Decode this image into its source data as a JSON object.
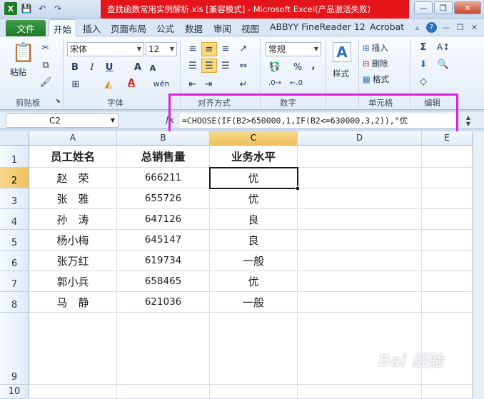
{
  "window": {
    "title": "查找函数常用实例解析.xls  [兼容模式] - Microsoft Excel(产品激活失败)",
    "buttons": {
      "minimize": "—",
      "restore": "❐",
      "close": "✕"
    }
  },
  "qat": {
    "save": "💾",
    "undo": "↶",
    "redo": "↷"
  },
  "tabs": {
    "file": "文件",
    "items": [
      "开始",
      "插入",
      "页面布局",
      "公式",
      "数据",
      "审阅",
      "视图",
      "ABBYY FineReader 12",
      "Acrobat"
    ],
    "active": "开始"
  },
  "ribbon": {
    "clipboard": {
      "paste": "粘贴",
      "label": "剪贴板"
    },
    "font": {
      "name": "宋体",
      "size": "12",
      "bold": "B",
      "italic": "I",
      "underline": "U",
      "grow": "A",
      "shrink": "A",
      "fontcolor": "A",
      "label": "字体"
    },
    "alignment": {
      "label": "对齐方式"
    },
    "number": {
      "format": "常规",
      "percent": "%",
      "comma": ",",
      "label": "数字"
    },
    "styles": {
      "label": "样式"
    },
    "cells": {
      "insert": "插入",
      "delete": "删除",
      "format": "格式",
      "label": "单元格"
    },
    "editing": {
      "sum": "Σ",
      "label": "编辑"
    }
  },
  "formula_bar": {
    "name_box": "C2",
    "fx": "fx",
    "formula": "=CHOOSE(IF(B2>650000,1,IF(B2<=630000,3,2)),\"优"
  },
  "grid": {
    "columns": [
      "A",
      "B",
      "C",
      "D",
      "E"
    ],
    "selected_column": "C",
    "rows": [
      "1",
      "2",
      "3",
      "4",
      "5",
      "6",
      "7",
      "8",
      "9",
      "10"
    ],
    "selected_row": "2",
    "active_cell": "C2",
    "header_row": [
      "员工姓名",
      "总销售量",
      "业务水平"
    ],
    "data_rows": [
      [
        "赵　荣",
        "666211",
        "优"
      ],
      [
        "张　雅",
        "655726",
        "优"
      ],
      [
        "孙　涛",
        "647126",
        "良"
      ],
      [
        "杨小梅",
        "645147",
        "良"
      ],
      [
        "张万红",
        "619734",
        "一般"
      ],
      [
        "郭小兵",
        "658465",
        "优"
      ],
      [
        "马　静",
        "621036",
        "一般"
      ]
    ]
  },
  "watermark": "Bai 经验",
  "colors": {
    "file_tab": "#2a8a35",
    "title_highlight": "#e3141a",
    "annotation": "#e11ee0",
    "selection": "#f1c15a"
  }
}
